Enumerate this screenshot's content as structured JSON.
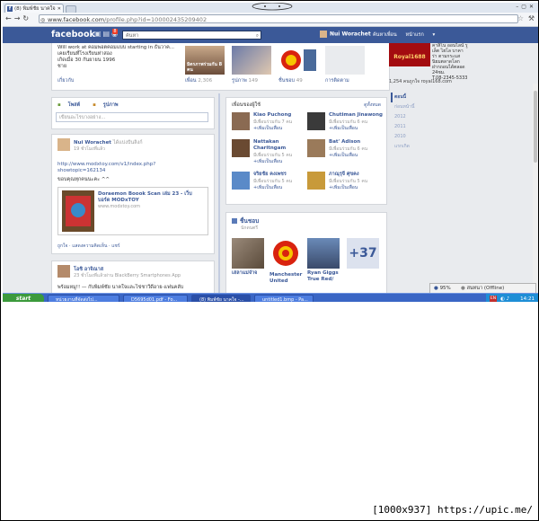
{
  "browser": {
    "tab_title": "(8) พิมพ์ชัย นาคใจ",
    "url_host": "www.facebook.com",
    "url_path": "/profile.php?id=100002435209402"
  },
  "fb": {
    "logo": "facebook",
    "notif_count": "8",
    "search_placeholder": "ค้นหา",
    "user_name": "Nui Worachet",
    "nav": [
      "ค้นหาเพื่อน",
      "หน้าแรก"
    ]
  },
  "about": {
    "lines": [
      "Will work at คอมพอตคอมแบบ starting in ธันวาค...",
      "เคยเรียนที่โรงเรียนท่าสอง",
      "เกิดเมื่อ 30 กันยายน 1996",
      "ชาย"
    ],
    "about_link": "เกี่ยวกับ",
    "thumb_caption": "มิตรภาพร่วมกัน 8 คน",
    "tiles": [
      {
        "label": "เพื่อน",
        "count": "2,306"
      },
      {
        "label": "รูปภาพ",
        "count": "149"
      },
      {
        "label": "ชื่นชอบ",
        "count": "49"
      },
      {
        "label": "การติดตาม",
        "count": ""
      }
    ]
  },
  "ad": {
    "brand": "Royal1688",
    "text": "คาสิโน ออนไลน์ รูเล็ต ไฮโล บาคาร่า ตามกระแสนิยมตลาดโลก ฝากถอนได้ตลอด 24ชม.",
    "phone": "T.08-2345-5333",
    "likes": "1,254 คนถูกใจ royal168.com"
  },
  "years": [
    "ตอนนี้",
    "ก่อนหน้านี้",
    "2012",
    "2011",
    "2010",
    "แรกเกิด"
  ],
  "composer": {
    "tabs": [
      "โพสต์",
      "รูปภาพ"
    ],
    "placeholder": "เขียนอะไรบางอย่าง..."
  },
  "post": {
    "author": "Nui Worachet",
    "author_suffix": "ได้แบ่งปันลิงก์",
    "time": "19 ชั่วโมงที่แล้ว",
    "link": "http://www.modxtoy.com/v1/index.php?showtopic=162134",
    "text": "ขอบคุณทุกคนนะคะ ^^",
    "share_title": "Doraemon Boook Scan เล่ม 23 - เว็บบอร์ด MODxTOY",
    "share_domain": "www.modxtoy.com",
    "actions": "ถูกใจ · แสดงความคิดเห็น · แชร์"
  },
  "post2": {
    "author": "โอชิ อาจิณาส",
    "meta": "23 ชั่วโมงที่แล้วผ่าน BlackBerry Smartphones App",
    "text": "พร้อมหมู!! — กับพิมพ์ชัย นาคใจและไข่ชาวีดีอาย-แฟนคลับ"
  },
  "friends": {
    "header": "เพื่อนของผู้ใช้",
    "see_all": "ดูทั้งหมด",
    "list": [
      {
        "name": "Kiao Puchong",
        "mutual": "มีเพื่อนร่วมกัน 7 คน",
        "btn": "+เพิ่มเป็นเพื่อน"
      },
      {
        "name": "Chutiman Jinawong",
        "mutual": "มีเพื่อนร่วมกัน 6 คน",
        "btn": "+เพิ่มเป็นเพื่อน"
      },
      {
        "name": "Nattakan Charitngam",
        "mutual": "มีเพื่อนร่วมกัน 5 คน",
        "btn": "+เพิ่มเป็นเพื่อน"
      },
      {
        "name": "Bat' Adison",
        "mutual": "มีเพื่อนร่วมกัน 6 คน",
        "btn": "+เพิ่มเป็นเพื่อน"
      },
      {
        "name": "จริยชัย คงเพชร",
        "mutual": "มีเพื่อนร่วมกัน 5 คน",
        "btn": "+เพิ่มเป็นเพื่อน"
      },
      {
        "name": "ภาณุรุจี ศุขคง",
        "mutual": "มีเพื่อนร่วมกัน 5 คน",
        "btn": "+เพิ่มเป็นเพื่อน"
      }
    ]
  },
  "likes": {
    "title": "ชื่นชอบ",
    "sub": "นักดนตรี",
    "items": [
      "เสลาแม่จ๋าจ",
      "Manchester United",
      "Ryan Giggs True Red/"
    ],
    "more": "+37"
  },
  "chat": {
    "zoom": "95%",
    "status": "สนทนา (Offline)"
  },
  "taskbar": {
    "start": "start",
    "tasks": [
      "หน่วยงานที่จัดส่งไป...",
      "D5695d01.pdf - Fo...",
      "(8) พิมพ์ชัย นาคใจ -...",
      "untitled1.bmp - Pa..."
    ],
    "lang": "EN",
    "clock": "14:21"
  },
  "caption": "[1000x937] https://upic.me/"
}
